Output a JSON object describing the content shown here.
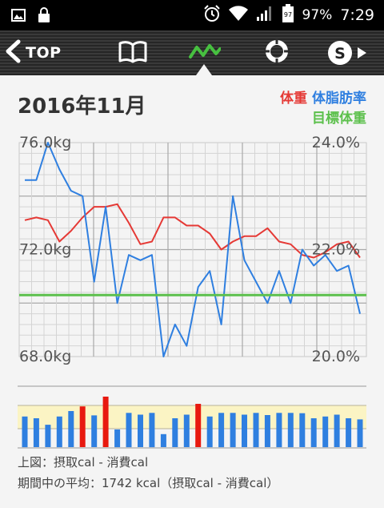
{
  "status_bar": {
    "battery_badge": "97",
    "battery_percent": "97%",
    "time": "7:29"
  },
  "nav": {
    "back_label": "TOP",
    "s_label": "S",
    "active_tab": "graph"
  },
  "header": {
    "title": "2016年11月"
  },
  "legend": {
    "weight_label": "体重",
    "fat_label": "体脂肪率",
    "target_label": "目標体重"
  },
  "colors": {
    "weight": "#e53935",
    "fat": "#2f7fe0",
    "target": "#5cc04c",
    "calorie_bar": "#2f7fe0",
    "calorie_bar_highlight": "#e8190f",
    "calorie_band": "#fbf4c4"
  },
  "chart_data": [
    {
      "type": "line",
      "x": [
        1,
        2,
        3,
        4,
        5,
        6,
        7,
        8,
        9,
        10,
        11,
        12,
        13,
        14,
        15,
        16,
        17,
        18,
        19,
        20,
        21,
        22,
        23,
        24,
        25,
        26,
        27,
        28,
        29,
        30
      ],
      "series": [
        {
          "name": "体重",
          "axis": "left",
          "values": [
            73.1,
            73.2,
            73.1,
            72.3,
            72.7,
            73.2,
            73.6,
            73.6,
            73.7,
            73.0,
            72.2,
            72.3,
            73.2,
            73.2,
            72.9,
            72.9,
            72.6,
            72.0,
            72.3,
            72.5,
            72.5,
            72.8,
            72.3,
            72.2,
            71.8,
            71.7,
            71.9,
            72.2,
            72.3,
            71.7
          ]
        },
        {
          "name": "体脂肪率",
          "axis": "right",
          "values": [
            23.3,
            23.3,
            24.0,
            23.5,
            23.1,
            23.0,
            21.4,
            22.8,
            21.0,
            21.9,
            21.8,
            21.9,
            20.0,
            20.6,
            20.2,
            21.3,
            21.6,
            20.6,
            23.0,
            21.8,
            21.4,
            21.0,
            21.6,
            21.0,
            22.0,
            21.7,
            21.9,
            21.6,
            21.7,
            20.8
          ]
        },
        {
          "name": "目標体重",
          "axis": "left",
          "values": [
            70.3,
            70.3,
            70.3,
            70.3,
            70.3,
            70.3,
            70.3,
            70.3,
            70.3,
            70.3,
            70.3,
            70.3,
            70.3,
            70.3,
            70.3,
            70.3,
            70.3,
            70.3,
            70.3,
            70.3,
            70.3,
            70.3,
            70.3,
            70.3,
            70.3,
            70.3,
            70.3,
            70.3,
            70.3,
            70.3
          ]
        }
      ],
      "y_left": {
        "min": 68.0,
        "max": 76.0,
        "ticks": [
          "76.0kg",
          "72.0kg",
          "68.0kg"
        ]
      },
      "y_right": {
        "min": 20.0,
        "max": 24.0,
        "ticks": [
          "24.0%",
          "22.0%",
          "20.0%"
        ]
      },
      "grid": true
    },
    {
      "type": "bar",
      "x": [
        1,
        2,
        3,
        4,
        5,
        6,
        7,
        8,
        9,
        10,
        11,
        12,
        13,
        14,
        15,
        16,
        17,
        18,
        19,
        20,
        21,
        22,
        23,
        24,
        25,
        26,
        27,
        28,
        29,
        30
      ],
      "values": [
        0.85,
        0.8,
        0.62,
        0.85,
        1.0,
        1.13,
        0.88,
        1.4,
        0.49,
        0.95,
        0.9,
        0.95,
        0.36,
        0.8,
        0.9,
        1.2,
        0.85,
        0.95,
        0.95,
        0.9,
        0.95,
        0.89,
        0.95,
        0.95,
        0.94,
        0.8,
        0.85,
        0.9,
        0.8,
        0.77
      ],
      "highlight": [
        false,
        false,
        false,
        false,
        false,
        true,
        false,
        true,
        false,
        false,
        false,
        false,
        false,
        false,
        false,
        true,
        false,
        false,
        false,
        false,
        false,
        false,
        false,
        false,
        false,
        false,
        false,
        false,
        false,
        false
      ]
    }
  ],
  "footer": {
    "line1": "上図：摂取cal - 消費cal",
    "line2": "期間中の平均：1742 kcal（摂取cal - 消費cal）"
  }
}
